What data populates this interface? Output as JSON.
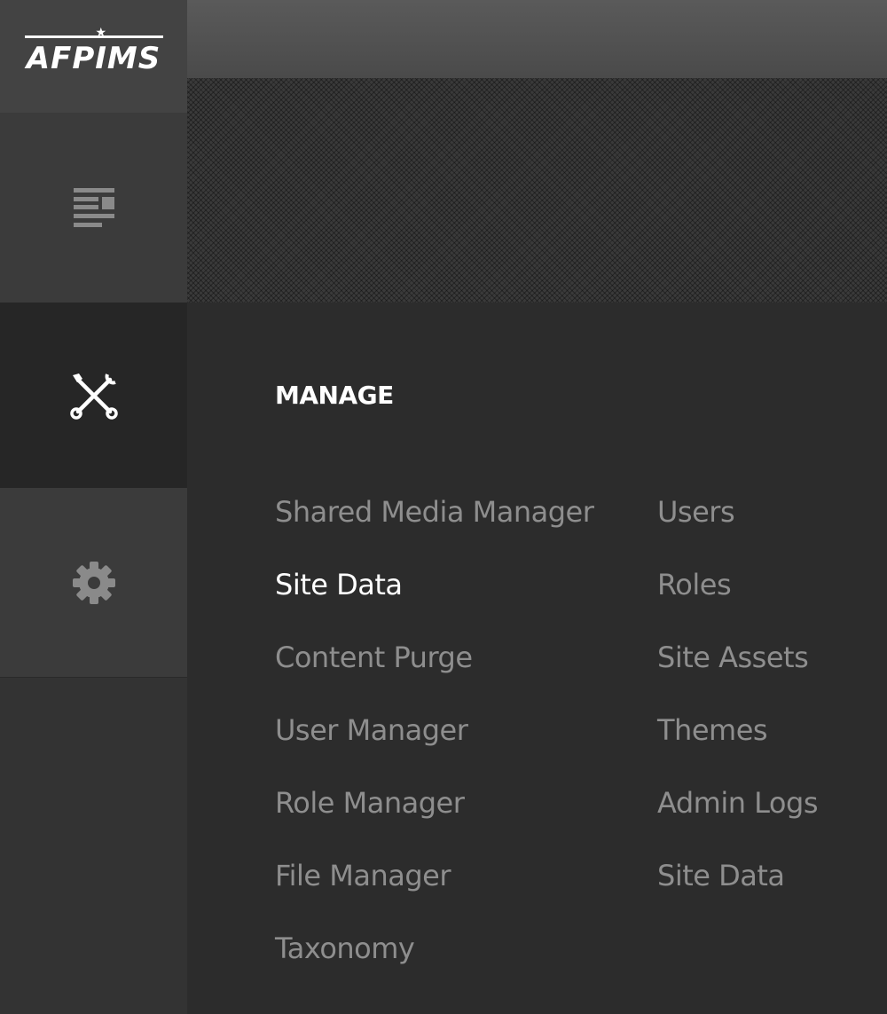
{
  "app": {
    "logo_text": "AFPIMS"
  },
  "sidebar": {
    "items": [
      {
        "icon": "content-list-icon"
      },
      {
        "icon": "wrench-screwdriver-icon",
        "active": true
      },
      {
        "icon": "gear-icon"
      }
    ]
  },
  "menu": {
    "title": "MANAGE",
    "left_column": [
      {
        "label": "Shared Media Manager"
      },
      {
        "label": "Site Data",
        "active": true
      },
      {
        "label": "Content Purge"
      },
      {
        "label": "User Manager"
      },
      {
        "label": "Role Manager"
      },
      {
        "label": "File Manager"
      },
      {
        "label": "Taxonomy"
      }
    ],
    "right_column": [
      {
        "label": "Users"
      },
      {
        "label": "Roles"
      },
      {
        "label": "Site Assets"
      },
      {
        "label": "Themes"
      },
      {
        "label": "Admin Logs"
      },
      {
        "label": "Site Data"
      }
    ]
  },
  "colors": {
    "sidebar_bg": "#333333",
    "active_nav_bg": "#262626",
    "link_inactive": "#8e8e8e",
    "link_active": "#ffffff"
  }
}
